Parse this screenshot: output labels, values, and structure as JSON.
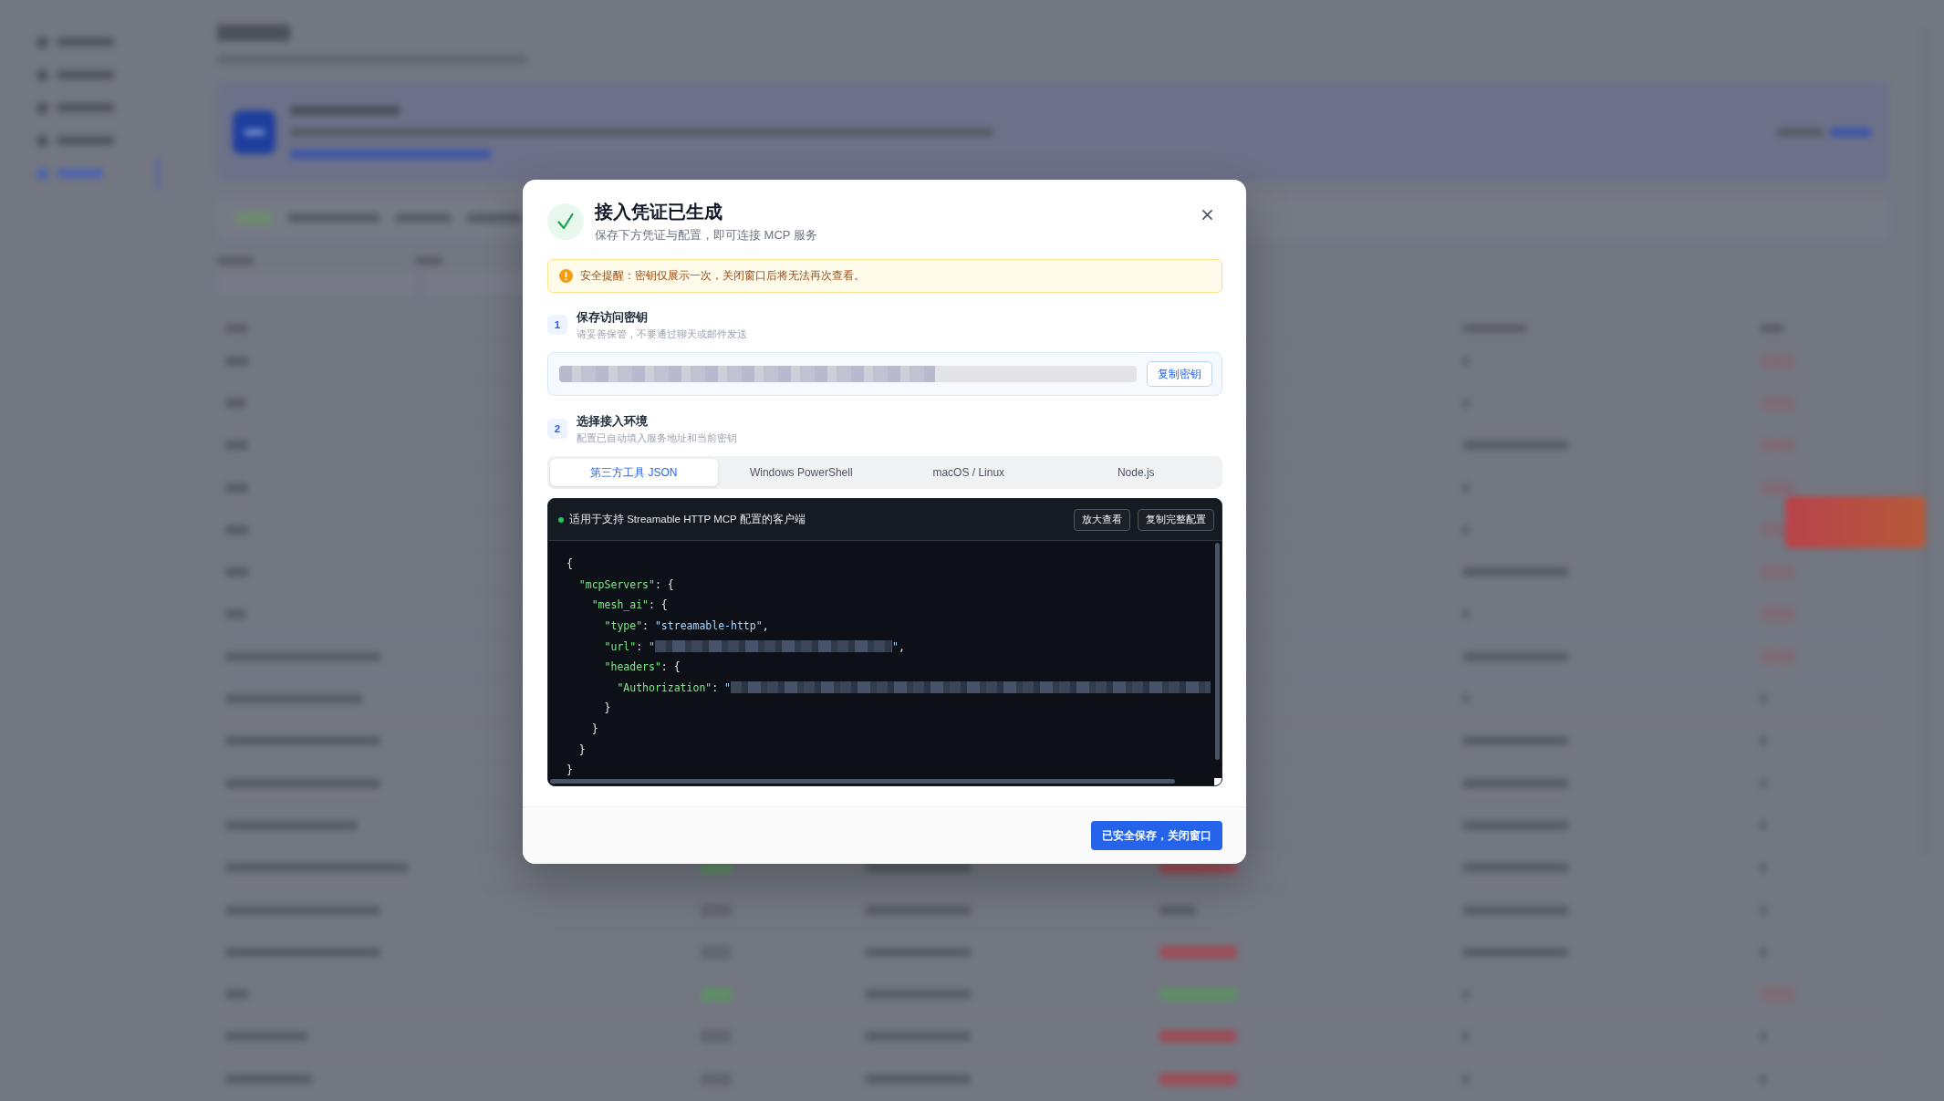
{
  "dialog": {
    "title": "接入凭证已生成",
    "subtitle": "保存下方凭证与配置，即可连接 MCP 服务",
    "alert": "安全提醒：密钥仅展示一次，关闭窗口后将无法再次查看。",
    "key_step": {
      "number": "1",
      "title": "保存访问密钥",
      "hint": "请妥善保管，不要通过聊天或邮件发送",
      "copy_button": "复制密钥"
    },
    "env_step": {
      "number": "2",
      "title": "选择接入环境",
      "hint": "配置已自动填入服务地址和当前密钥",
      "tabs": [
        {
          "label": "第三方工具 JSON",
          "selected": true
        },
        {
          "label": "Windows PowerShell",
          "selected": false
        },
        {
          "label": "macOS / Linux",
          "selected": false
        },
        {
          "label": "Node.js",
          "selected": false
        }
      ],
      "code": {
        "caption": "适用于支持 Streamable HTTP MCP 配置的客户端",
        "buttons": [
          "放大查看",
          "复制完整配置"
        ],
        "root": {
          "tokens": [
            {
              "kind": "punct",
              "text": "{"
            }
          ],
          "close": "}",
          "children": [
            {
              "tokens": [
                {
                  "kind": "key",
                  "text": "\"mcpServers\""
                },
                {
                  "kind": "punct",
                  "text": ": {"
                }
              ],
              "close": "}",
              "children": [
                {
                  "tokens": [
                    {
                      "kind": "key",
                      "text": "\"mesh_ai\""
                    },
                    {
                      "kind": "punct",
                      "text": ": {"
                    }
                  ],
                  "close": "}",
                  "children": [
                    {
                      "tokens": [
                        {
                          "kind": "key",
                          "text": "\"type\""
                        },
                        {
                          "kind": "punct",
                          "text": ": "
                        },
                        {
                          "kind": "string",
                          "text": "\"streamable-http\""
                        },
                        {
                          "kind": "punct",
                          "text": ","
                        }
                      ]
                    },
                    {
                      "tokens": [
                        {
                          "kind": "key",
                          "text": "\"url\""
                        },
                        {
                          "kind": "punct",
                          "text": ": "
                        },
                        {
                          "kind": "string",
                          "text": "\""
                        },
                        {
                          "kind": "redacted"
                        },
                        {
                          "kind": "string",
                          "text": "\""
                        },
                        {
                          "kind": "punct",
                          "text": ","
                        }
                      ]
                    },
                    {
                      "tokens": [
                        {
                          "kind": "key",
                          "text": "\"headers\""
                        },
                        {
                          "kind": "punct",
                          "text": ": {"
                        }
                      ],
                      "close": "}",
                      "children": [
                        {
                          "tokens": [
                            {
                              "kind": "key",
                              "text": "\"Authorization\""
                            },
                            {
                              "kind": "punct",
                              "text": ": "
                            },
                            {
                              "kind": "string",
                              "text": "\""
                            },
                            {
                              "kind": "redacted"
                            }
                          ]
                        }
                      ]
                    }
                  ]
                }
              ]
            }
          ]
        }
      }
    },
    "confirm_button": "已安全保存，关闭窗口"
  }
}
